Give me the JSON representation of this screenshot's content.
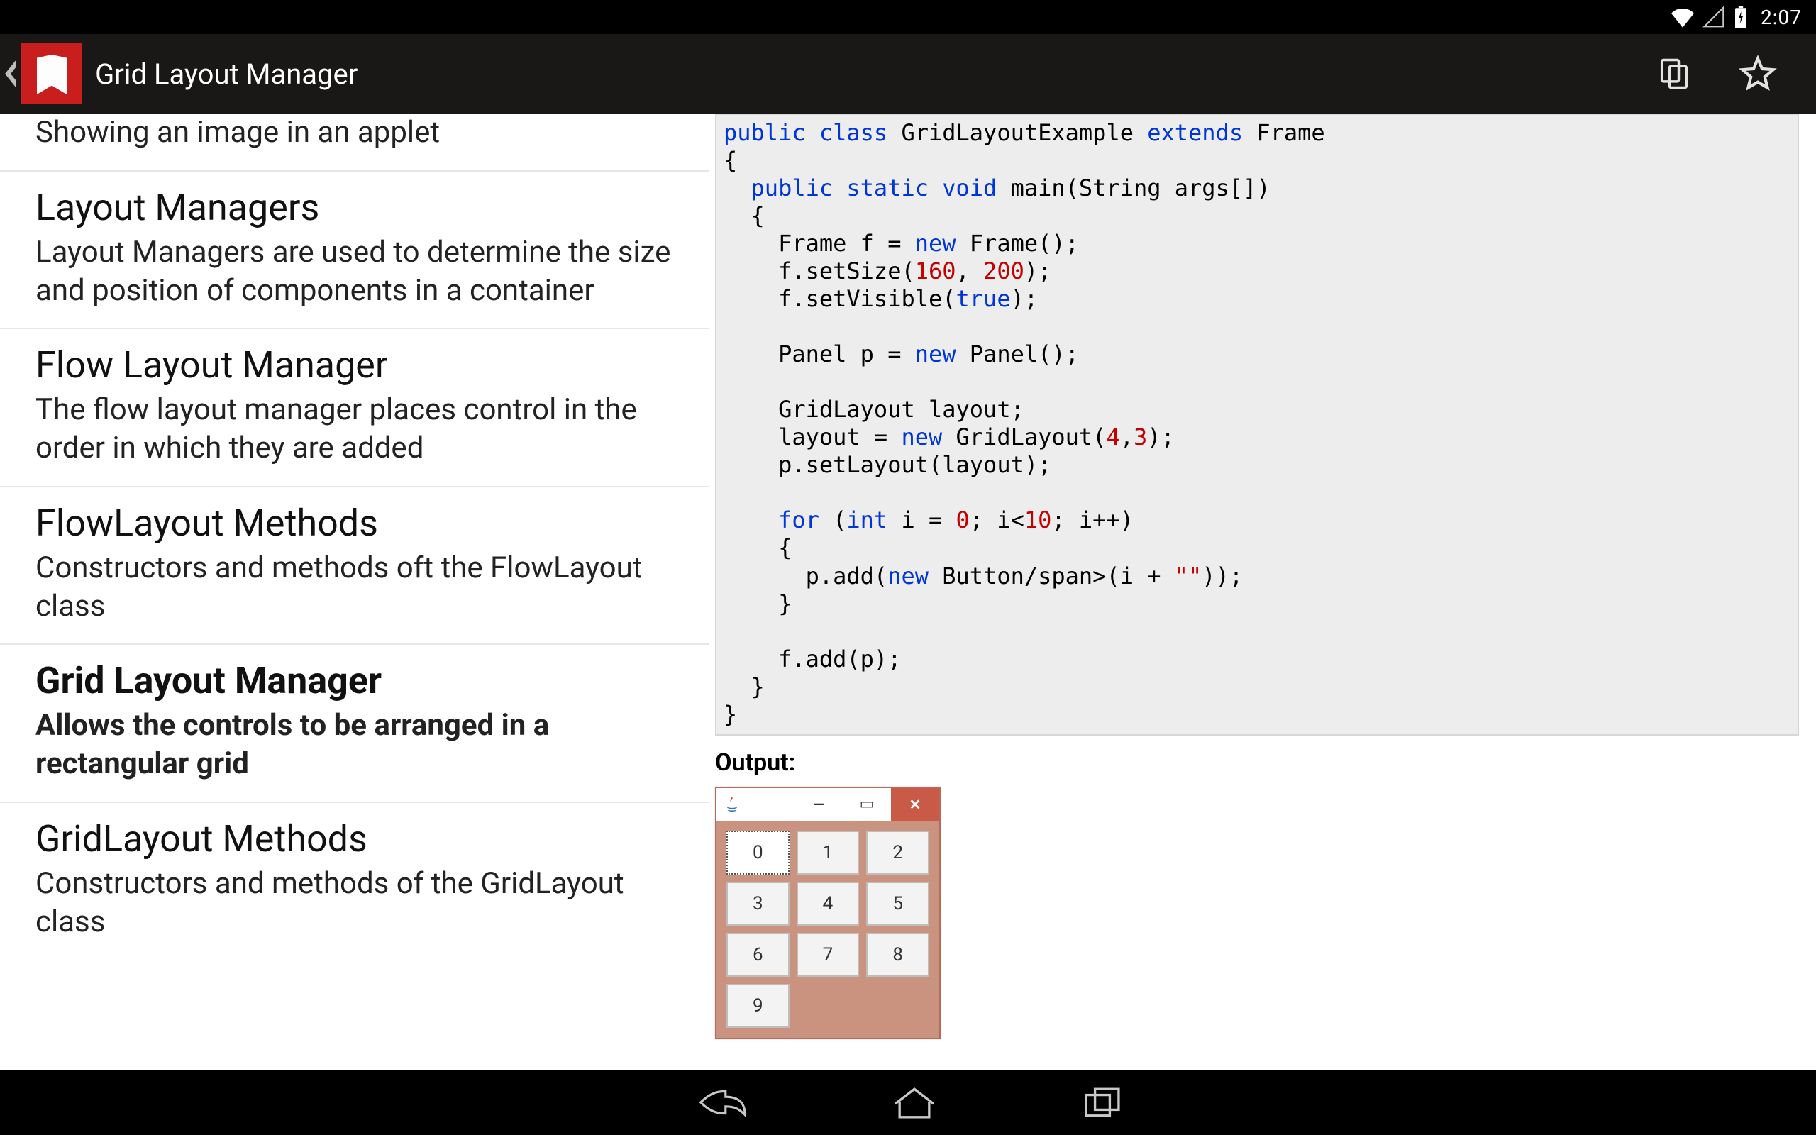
{
  "status": {
    "clock": "2:07"
  },
  "actionbar": {
    "title": "Grid Layout Manager"
  },
  "sidebar": {
    "items": [
      {
        "title": "",
        "desc": "Showing an image in an applet",
        "selected": false
      },
      {
        "title": "Layout Managers",
        "desc": "Layout Managers are used to determine the size and position of components in a container",
        "selected": false
      },
      {
        "title": "Flow Layout Manager",
        "desc": "The flow layout manager places control in the order in which they are added",
        "selected": false
      },
      {
        "title": "FlowLayout Methods",
        "desc": "Constructors and methods oft the FlowLayout class",
        "selected": false
      },
      {
        "title": "Grid Layout Manager",
        "desc": "Allows the controls to be arranged in a rectangular grid",
        "selected": true
      },
      {
        "title": "GridLayout Methods",
        "desc": "Constructors and methods of the GridLayout class",
        "selected": false
      }
    ]
  },
  "article": {
    "output_label": "Output:",
    "grid_buttons": [
      "0",
      "1",
      "2",
      "3",
      "4",
      "5",
      "6",
      "7",
      "8",
      "9"
    ],
    "grid_cols": 3,
    "grid_rows": 4,
    "code_tokens": [
      {
        "t": "kw",
        "v": "public"
      },
      {
        "t": "sp",
        "v": " "
      },
      {
        "t": "kw",
        "v": "class"
      },
      {
        "t": "sp",
        "v": " "
      },
      {
        "t": "p",
        "v": "GridLayoutExample "
      },
      {
        "t": "kw",
        "v": "extends"
      },
      {
        "t": "sp",
        "v": " "
      },
      {
        "t": "p",
        "v": "Frame"
      },
      {
        "t": "br"
      },
      {
        "t": "p",
        "v": "{"
      },
      {
        "t": "br"
      },
      {
        "t": "p",
        "v": "  "
      },
      {
        "t": "kw",
        "v": "public"
      },
      {
        "t": "sp",
        "v": " "
      },
      {
        "t": "kw",
        "v": "static"
      },
      {
        "t": "sp",
        "v": " "
      },
      {
        "t": "kw",
        "v": "void"
      },
      {
        "t": "sp",
        "v": " "
      },
      {
        "t": "p",
        "v": "main(String args[])"
      },
      {
        "t": "br"
      },
      {
        "t": "p",
        "v": "  "
      },
      {
        "t": "p",
        "v": "{"
      },
      {
        "t": "br"
      },
      {
        "t": "p",
        "v": "    Frame f = "
      },
      {
        "t": "kw",
        "v": "new"
      },
      {
        "t": "sp",
        "v": " "
      },
      {
        "t": "p",
        "v": "Frame();"
      },
      {
        "t": "br"
      },
      {
        "t": "p",
        "v": "    f.setSize("
      },
      {
        "t": "num",
        "v": "160"
      },
      {
        "t": "p",
        "v": ", "
      },
      {
        "t": "num",
        "v": "200"
      },
      {
        "t": "p",
        "v": ");"
      },
      {
        "t": "br"
      },
      {
        "t": "p",
        "v": "    f.setVisible("
      },
      {
        "t": "kw",
        "v": "true"
      },
      {
        "t": "p",
        "v": ");"
      },
      {
        "t": "br"
      },
      {
        "t": "br"
      },
      {
        "t": "p",
        "v": "    Panel p = "
      },
      {
        "t": "kw",
        "v": "new"
      },
      {
        "t": "sp",
        "v": " "
      },
      {
        "t": "p",
        "v": "Panel();"
      },
      {
        "t": "br"
      },
      {
        "t": "br"
      },
      {
        "t": "p",
        "v": "    GridLayout layout;"
      },
      {
        "t": "br"
      },
      {
        "t": "p",
        "v": "    layout = "
      },
      {
        "t": "kw",
        "v": "new"
      },
      {
        "t": "sp",
        "v": " "
      },
      {
        "t": "p",
        "v": "GridLayout("
      },
      {
        "t": "num",
        "v": "4"
      },
      {
        "t": "p",
        "v": ","
      },
      {
        "t": "num",
        "v": "3"
      },
      {
        "t": "p",
        "v": ");"
      },
      {
        "t": "br"
      },
      {
        "t": "p",
        "v": "    p.setLayout(layout);"
      },
      {
        "t": "br"
      },
      {
        "t": "br"
      },
      {
        "t": "p",
        "v": "    "
      },
      {
        "t": "kw",
        "v": "for"
      },
      {
        "t": "sp",
        "v": " "
      },
      {
        "t": "p",
        "v": "("
      },
      {
        "t": "kw",
        "v": "int"
      },
      {
        "t": "sp",
        "v": " "
      },
      {
        "t": "p",
        "v": "i = "
      },
      {
        "t": "num",
        "v": "0"
      },
      {
        "t": "p",
        "v": "; i<"
      },
      {
        "t": "num",
        "v": "10"
      },
      {
        "t": "p",
        "v": "; i++)"
      },
      {
        "t": "br"
      },
      {
        "t": "p",
        "v": "    {"
      },
      {
        "t": "br"
      },
      {
        "t": "p",
        "v": "      p.add("
      },
      {
        "t": "kw",
        "v": "new"
      },
      {
        "t": "sp",
        "v": " "
      },
      {
        "t": "p",
        "v": "Button/span>(i + "
      },
      {
        "t": "str",
        "v": "\"\""
      },
      {
        "t": "p",
        "v": "));"
      },
      {
        "t": "br"
      },
      {
        "t": "p",
        "v": "    }"
      },
      {
        "t": "br"
      },
      {
        "t": "br"
      },
      {
        "t": "p",
        "v": "    f.add(p);"
      },
      {
        "t": "br"
      },
      {
        "t": "p",
        "v": "  }"
      },
      {
        "t": "br"
      },
      {
        "t": "p",
        "v": "}"
      }
    ]
  }
}
